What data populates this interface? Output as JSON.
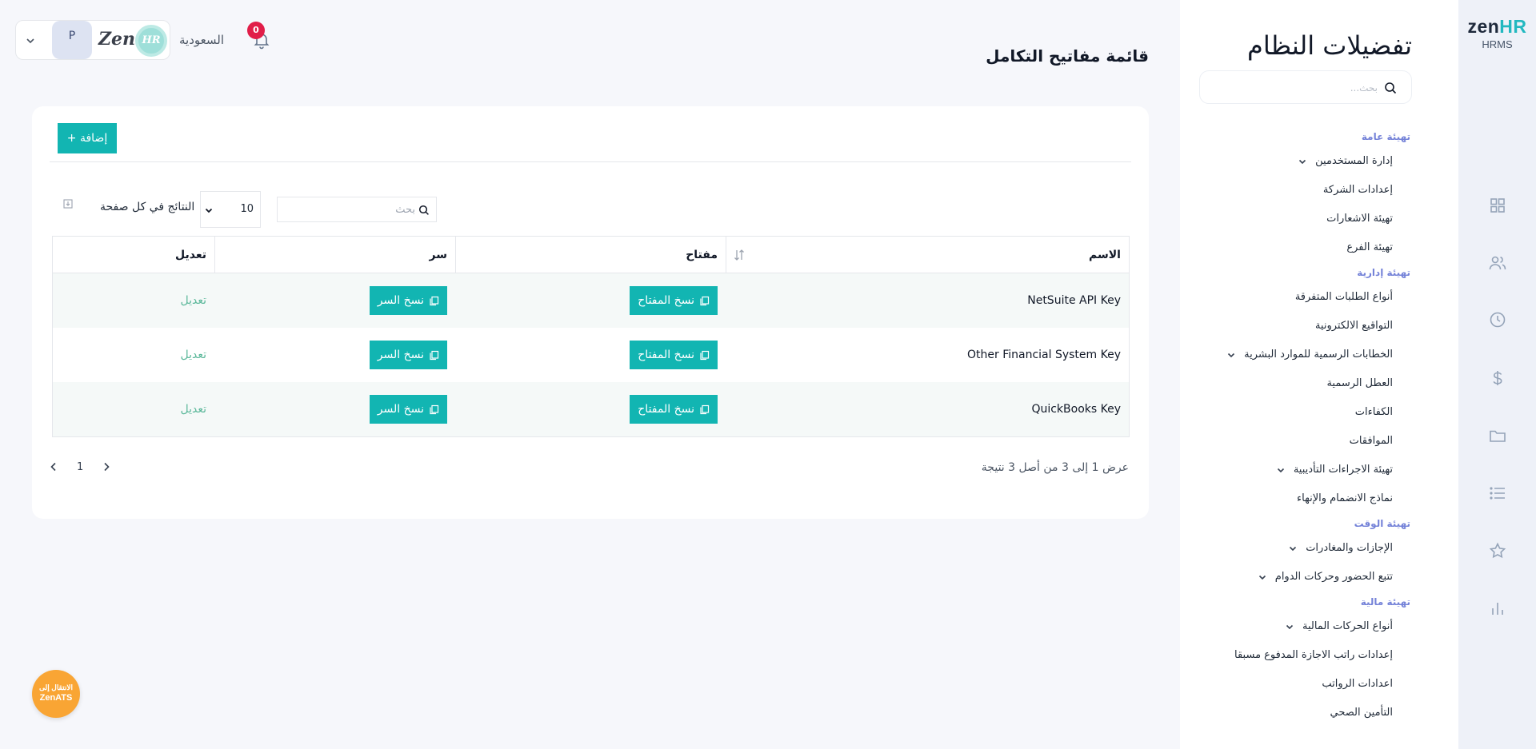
{
  "brand": {
    "logo_zen": "zen",
    "logo_hr": "HR",
    "product": "HRMS"
  },
  "rail": {
    "icons": [
      "grid-icon",
      "users-icon",
      "clock-icon",
      "dollar-icon",
      "folder-icon",
      "list-icon",
      "star-icon",
      "bar-chart-icon"
    ]
  },
  "settings": {
    "title": "تفضيلات النظام",
    "search_placeholder": "بحث...",
    "nav": [
      {
        "type": "section",
        "label": "تهيئة عامة"
      },
      {
        "type": "item",
        "label": "إدارة المستخدمين",
        "has_children": true
      },
      {
        "type": "item",
        "label": "إعدادات الشركة",
        "has_children": false
      },
      {
        "type": "item",
        "label": "تهيئة الاشعارات",
        "has_children": false
      },
      {
        "type": "item",
        "label": "تهيئة الفرع",
        "has_children": false
      },
      {
        "type": "section",
        "label": "تهيئة إدارية"
      },
      {
        "type": "item",
        "label": "أنواع الطلبات المتفرقة",
        "has_children": false
      },
      {
        "type": "item",
        "label": "التواقيع الالكترونية",
        "has_children": false
      },
      {
        "type": "item",
        "label": "الخطابات الرسمية للموارد البشرية",
        "has_children": true
      },
      {
        "type": "item",
        "label": "العطل الرسمية",
        "has_children": false
      },
      {
        "type": "item",
        "label": "الكفاءات",
        "has_children": false
      },
      {
        "type": "item",
        "label": "الموافقات",
        "has_children": false
      },
      {
        "type": "item",
        "label": "تهيئة الاجراءات التأديبية",
        "has_children": true
      },
      {
        "type": "item",
        "label": "نماذج الانضمام والإنهاء",
        "has_children": false
      },
      {
        "type": "section",
        "label": "تهيئة الوقت"
      },
      {
        "type": "item",
        "label": "الإجازات والمغادرات",
        "has_children": true
      },
      {
        "type": "item",
        "label": "تتبع الحضور وحركات الدوام",
        "has_children": true
      },
      {
        "type": "section",
        "label": "تهيئة مالية"
      },
      {
        "type": "item",
        "label": "أنواع الحركات المالية",
        "has_children": true
      },
      {
        "type": "item",
        "label": "إعدادات راتب الاجازة المدفوع مسبقا",
        "has_children": false
      },
      {
        "type": "item",
        "label": "اعدادات الرواتب",
        "has_children": false
      },
      {
        "type": "item",
        "label": "التأمين الصحي",
        "has_children": false
      }
    ]
  },
  "topbar": {
    "avatar_initial": "P",
    "company_logo_zen": "Zen",
    "company_logo_hr": "HR",
    "country": "السعودية",
    "notification_count": "0"
  },
  "page": {
    "title": "قائمة مفاتيح التكامل",
    "add_label": "+ إضافة",
    "per_page_label": "النتائج في كل صفحة",
    "per_page_value": "10",
    "search_placeholder": "بحث",
    "columns": {
      "name": "الاسم",
      "key": "مفتاح",
      "secret": "سر",
      "edit": "تعديل"
    },
    "copy_key_label": "نسخ المفتاح",
    "copy_secret_label": "نسخ السر",
    "edit_label": "تعديل",
    "rows": [
      {
        "name": "NetSuite API Key"
      },
      {
        "name": "Other Financial System Key"
      },
      {
        "name": "QuickBooks Key"
      }
    ],
    "current_page": "1",
    "summary": "عرض 1 إلى 3 من أصل 3 نتيجة"
  },
  "zenats": {
    "line1": "الانتقال إلى",
    "line2": "ZenATS"
  },
  "colors": {
    "accent": "#12b5b2",
    "section": "#7482d8",
    "badge": "#e11d48",
    "zenats": "#f9a534",
    "edit": "#5bb89a"
  }
}
